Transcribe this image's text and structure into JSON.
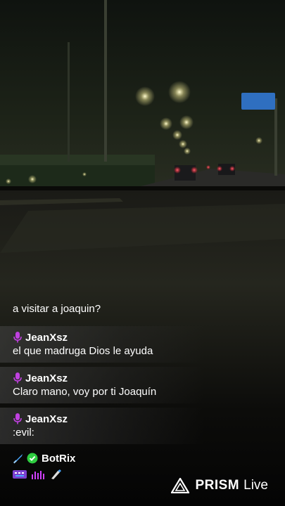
{
  "stream": {
    "background_scene": "night-road-dashcam"
  },
  "chat": {
    "messages": [
      {
        "user": "",
        "text": "a visitar a joaquin?"
      },
      {
        "user": "JeanXsz",
        "text": "el que madruga Dios le ayuda"
      },
      {
        "user": "JeanXsz",
        "text": "Claro mano, voy por ti Joaquín"
      },
      {
        "user": "JeanXsz",
        "text": ":evil:"
      },
      {
        "user": "BotRix",
        "text": ""
      }
    ]
  },
  "brand": {
    "name": "PRISM",
    "suffix": "Live"
  },
  "colors": {
    "mic_icon": "#c040e0",
    "verified": "#2ecc40",
    "sword": "#4aa8ff",
    "text": "#ffffff"
  }
}
